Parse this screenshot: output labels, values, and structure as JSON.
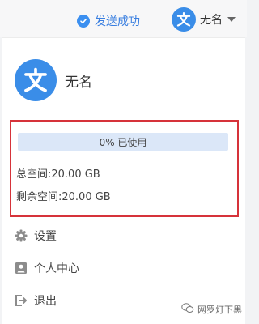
{
  "header": {
    "status_text": "发送成功",
    "username": "无名"
  },
  "profile": {
    "name": "无名",
    "avatar_glyph": "文"
  },
  "storage": {
    "usage_label": "0% 已使用",
    "used_fraction": 0,
    "total_label": "总空间:20.00 GB",
    "remaining_label": "剩余空间:20.00 GB"
  },
  "menu": [
    {
      "label": "设置",
      "icon": "gear-icon"
    },
    {
      "label": "个人中心",
      "icon": "person-icon"
    },
    {
      "label": "退出",
      "icon": "exit-icon"
    }
  ],
  "watermark": {
    "text": "网罗灯下黑"
  },
  "colors": {
    "accent": "#3a8de8",
    "highlight_border": "#d6333a",
    "usage_bar_bg": "#dbe7f8"
  }
}
